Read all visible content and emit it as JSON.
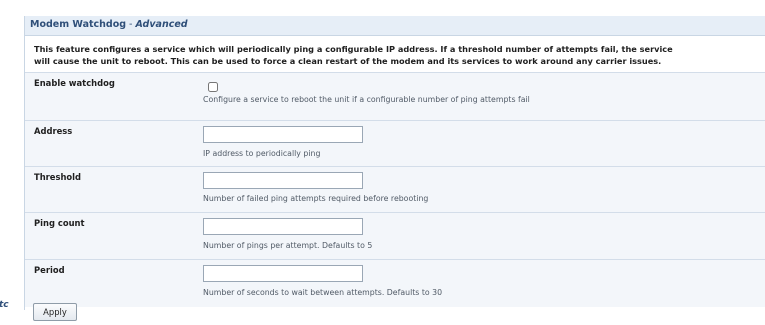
{
  "header": {
    "title": "Modem Watchdog",
    "separator": "-",
    "mode": "Advanced"
  },
  "intro": {
    "line1": "This feature configures a service which will periodically ping a configurable IP address. If a threshold number of attempts fail, the service",
    "line2": "will cause the unit to reboot. This can be used to force a clean restart of the modem and its services to work around any carrier issues."
  },
  "fields": {
    "enable": {
      "label": "Enable watchdog",
      "checked": false,
      "help": "Configure a service to reboot the unit if a configurable number of ping attempts fail"
    },
    "address": {
      "label": "Address",
      "value": "",
      "help": "IP address to periodically ping"
    },
    "threshold": {
      "label": "Threshold",
      "value": "",
      "help": "Number of failed ping attempts required before rebooting"
    },
    "ping_count": {
      "label": "Ping count",
      "value": "",
      "help": "Number of pings per attempt. Defaults to 5"
    },
    "period": {
      "label": "Period",
      "value": "",
      "help": "Number of seconds to wait between attempts. Defaults to 30"
    }
  },
  "actions": {
    "apply_label": "Apply"
  },
  "edge_fragment": "tc",
  "colors": {
    "header_bg": "#e6eef7",
    "header_text": "#2f4f79",
    "row_bg": "#f3f6fa",
    "border": "#c9d6e4"
  }
}
